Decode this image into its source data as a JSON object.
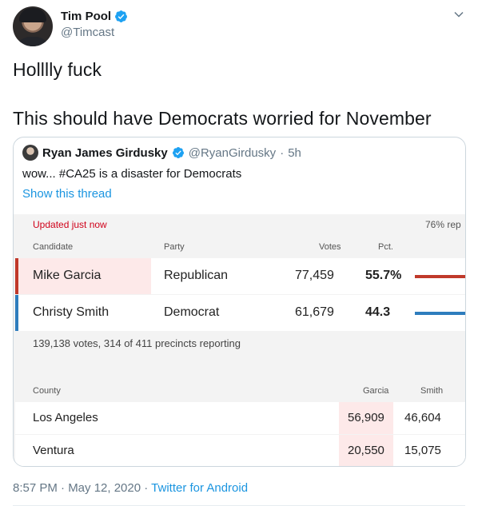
{
  "author": {
    "display_name": "Tim Pool",
    "handle": "@Timcast"
  },
  "tweet": {
    "line1": "Holllly fuck",
    "line2": "This should have Democrats worried for November"
  },
  "quoted": {
    "display_name": "Ryan James Girdusky",
    "handle": "@RyanGirdusky",
    "separator": "·",
    "time": "5h",
    "text": "wow... #CA25 is a disaster for Democrats",
    "show_thread": "Show this thread"
  },
  "results": {
    "updated": "Updated just now",
    "reporting": "76% rep",
    "headers": {
      "candidate": "Candidate",
      "party": "Party",
      "votes": "Votes",
      "pct": "Pct."
    },
    "candidates": [
      {
        "name": "Mike Garcia",
        "party": "Republican",
        "votes": "77,459",
        "pct": "55.7%",
        "color": "#c0392b"
      },
      {
        "name": "Christy Smith",
        "party": "Democrat",
        "votes": "61,679",
        "pct": "44.3",
        "color": "#2e7dbd"
      }
    ],
    "summary": "139,138 votes, 314 of 411 precincts reporting",
    "county_headers": {
      "county": "County",
      "garcia": "Garcia",
      "smith": "Smith"
    },
    "counties": [
      {
        "name": "Los Angeles",
        "garcia": "56,909",
        "smith": "46,604"
      },
      {
        "name": "Ventura",
        "garcia": "20,550",
        "smith": "15,075"
      }
    ]
  },
  "meta": {
    "timestamp": "8:57 PM · May 12, 2020 · ",
    "source": "Twitter for Android"
  },
  "colors": {
    "verified": "#1da1f2",
    "link": "#1b95e0",
    "updated": "#d0021b",
    "highlight": "#fde9e9"
  }
}
